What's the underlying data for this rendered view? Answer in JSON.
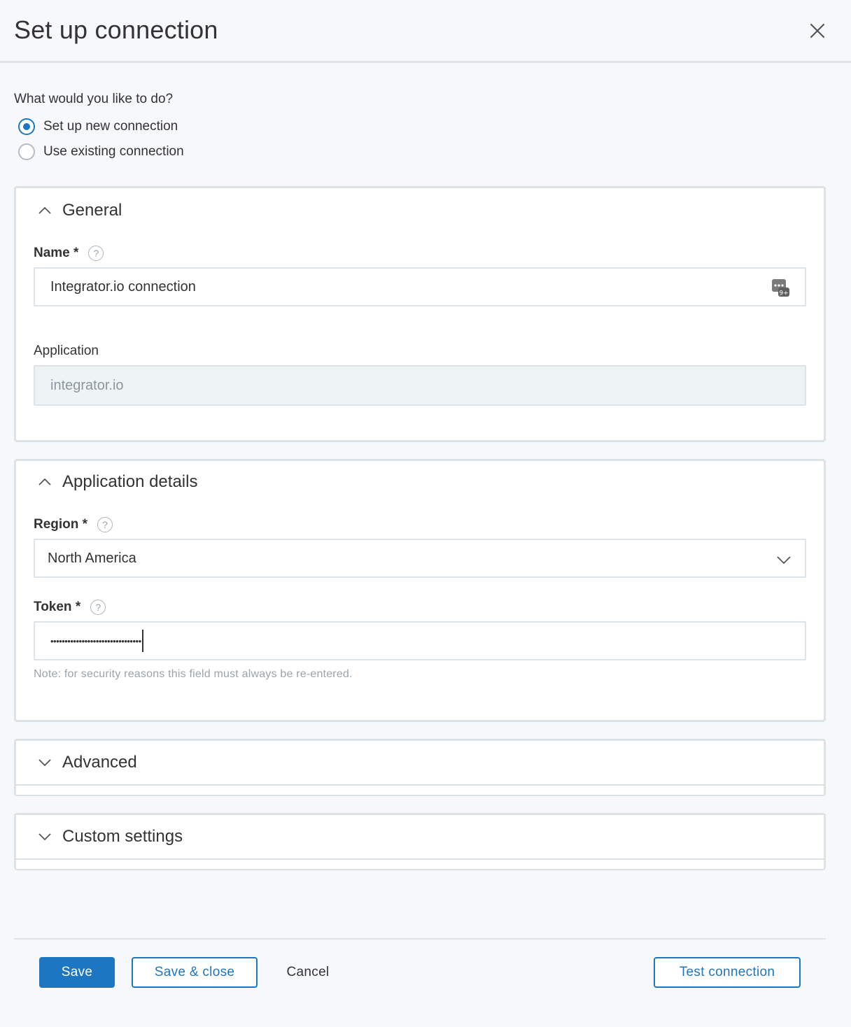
{
  "header": {
    "title": "Set up connection"
  },
  "question": "What would you like to do?",
  "options": [
    {
      "label": "Set up new connection",
      "selected": true
    },
    {
      "label": "Use existing connection",
      "selected": false
    }
  ],
  "sections": {
    "general": {
      "title": "General",
      "name_label": "Name *",
      "name_value": "Integrator.io connection",
      "application_label": "Application",
      "application_value": "integrator.io"
    },
    "app_details": {
      "title": "Application details",
      "region_label": "Region *",
      "region_value": "North America",
      "token_label": "Token *",
      "token_value": "••••••••••••••••••••••••••••••••",
      "token_note": "Note: for security reasons this field must always be re-entered."
    },
    "advanced": {
      "title": "Advanced"
    },
    "custom": {
      "title": "Custom settings"
    }
  },
  "footer": {
    "save": "Save",
    "save_close": "Save & close",
    "cancel": "Cancel",
    "test": "Test connection"
  },
  "colors": {
    "accent": "#1d76c2",
    "border": "#dce3e7",
    "background": "#f7f8fc"
  },
  "icons": [
    "close-icon",
    "chevron-up-icon",
    "chevron-down-icon",
    "help-icon",
    "password-manager-icon"
  ]
}
